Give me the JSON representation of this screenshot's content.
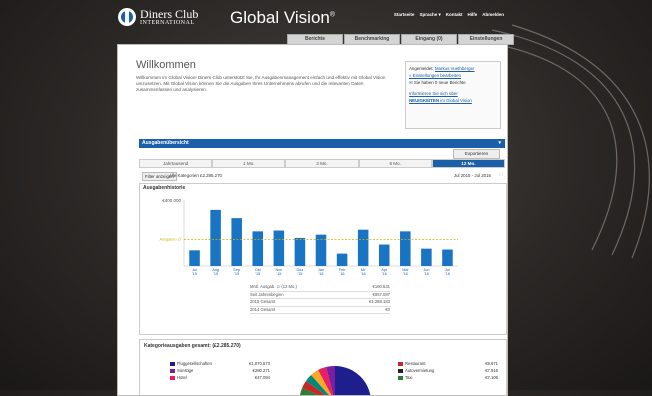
{
  "header": {
    "brand_line1": "Diners Club",
    "brand_line2": "INTERNATIONAL",
    "product": "Global Vision",
    "product_mark": "®",
    "links": [
      "Startseite",
      "Sprache ▾",
      "Kontakt",
      "Hilfe",
      "Abmelden"
    ],
    "tabs": [
      "Berichte",
      "Benchmarking",
      "Eingang (0)",
      "Einstellungen"
    ]
  },
  "welcome": {
    "title": "Willkommen",
    "text": "Willkommen im Global Vision! Diners Club unterstützt Sie, Ihr Ausgabenmanagement einfach und effektiv mit Global Vision umzusetzen. Mit Global Vision können Sie die Ausgaben Ihres Unternehmens abrufen und die relevanten Daten zusammenfassen und analysieren."
  },
  "userbox": {
    "logged_in_label": "Angemeldet:",
    "user": "Markus Vuethberger",
    "edit": "» Einstellungen bearbeiten",
    "reports": "Sie haben 0 neue Berichte",
    "info1": "Informieren Sie sich über",
    "info2": "NEUIGKEITEN",
    "info3": " im Global Vision"
  },
  "overview": {
    "title": "Ausgabenübersicht",
    "arrow": "▾",
    "export": "Exportieren",
    "periods": [
      "Jahrtausend",
      "1 Mo.",
      "3 Mo.",
      "6 Mo.",
      "12 Mo."
    ],
    "filter_btn": "Filter anzeigen",
    "category": "Alle Kategorien £2.285.270",
    "range": "Jul 2015 - Jul 2016",
    "nav": "‹ ›"
  },
  "history": {
    "title": "Ausgabenhistorie",
    "stats": [
      [
        "Mntl. Ausgab. ∅ (12 Mo.)",
        "€160.531"
      ],
      [
        "Seit Jahresbeginn",
        "€957.087"
      ],
      [
        "2015 Gesamt",
        "€1.288.183"
      ],
      [
        "2014 Gesamt",
        "€0"
      ]
    ]
  },
  "categories": {
    "title": "Kategorieausgaben gesamt: (£2.285.270)",
    "left": [
      {
        "name": "Fluggesellschaften",
        "value": "€1.070.573",
        "color": "#1e1e8c"
      },
      {
        "name": "Sonstige",
        "value": "€280.271",
        "color": "#7b1fa2"
      },
      {
        "name": "Hotel",
        "value": "€47.094",
        "color": "#e91e63"
      }
    ],
    "right": [
      {
        "name": "Restaurant",
        "value": "€9.671",
        "color": "#c62828"
      },
      {
        "name": "Autovermietung",
        "value": "€7.916",
        "color": "#222222"
      },
      {
        "name": "Taxi",
        "value": "€7.106",
        "color": "#2e7d32"
      }
    ]
  },
  "chart_data": {
    "type": "bar",
    "title": "Ausgabenhistorie",
    "ylabel": "",
    "categories": [
      "Jul '15",
      "Aug '15",
      "Sep '15",
      "Okt '15",
      "Nov '15",
      "Dez '15",
      "Jan '16",
      "Feb '16",
      "Mr '16",
      "Apr '16",
      "Mai '16",
      "Jun '16",
      "Jul '16"
    ],
    "values": [
      95,
      340,
      290,
      210,
      215,
      170,
      190,
      75,
      220,
      130,
      210,
      105,
      100
    ],
    "average_line": {
      "label": "Ausgaben ∅",
      "value": 160
    },
    "y_tick_label": "€400.000",
    "ylim": [
      0,
      400
    ],
    "grid": false,
    "bar_color": "#1a74c4",
    "avg_color": "#c8b400"
  }
}
